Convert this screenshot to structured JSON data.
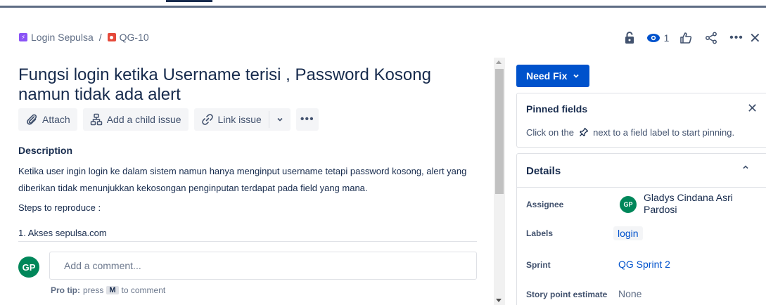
{
  "breadcrumb": {
    "project": "Login Sepulsa",
    "separator": "/",
    "issue_key": "QG-10"
  },
  "header_actions": {
    "watch_count": "1",
    "icons": [
      "lock-icon",
      "eye-icon",
      "thumbs-up-icon",
      "share-icon",
      "more-icon",
      "close-icon"
    ]
  },
  "issue": {
    "title": "Fungsi login ketika Username terisi , Password Kosong namun tidak ada alert"
  },
  "toolbar": {
    "attach": "Attach",
    "add_child": "Add a child issue",
    "link_issue": "Link issue",
    "more": "•••"
  },
  "description": {
    "heading": "Description",
    "text": "Ketika user ingin login ke dalam sistem namun hanya menginput username tetapi password kosong, alert yang diberikan tidak menunjukkan kekosongan penginputan terdapat pada field yang mana.",
    "steps_heading": "Steps to reproduce :",
    "step_1": "1. Akses sepulsa.com"
  },
  "comment": {
    "avatar_initials": "GP",
    "placeholder": "Add a comment...",
    "protip_label": "Pro tip:",
    "protip_pre": "press",
    "protip_key": "M",
    "protip_post": "to comment"
  },
  "status": {
    "label": "Need Fix",
    "color": "#0052cc"
  },
  "pinned_fields": {
    "title": "Pinned fields",
    "hint_pre": "Click on the",
    "hint_post": "next to a field label to start pinning."
  },
  "details": {
    "title": "Details",
    "assignee_label": "Assignee",
    "assignee_initials": "GP",
    "assignee_name": "Gladys Cindana Asri Pardosi",
    "labels_label": "Labels",
    "labels_value": "login",
    "sprint_label": "Sprint",
    "sprint_value": "QG Sprint 2",
    "story_points_label": "Story point estimate",
    "story_points_value": "None"
  },
  "colors": {
    "brand_blue": "#0052cc",
    "avatar_green": "#00875a",
    "project_purple": "#8a53f6",
    "bug_red": "#e5493a"
  }
}
